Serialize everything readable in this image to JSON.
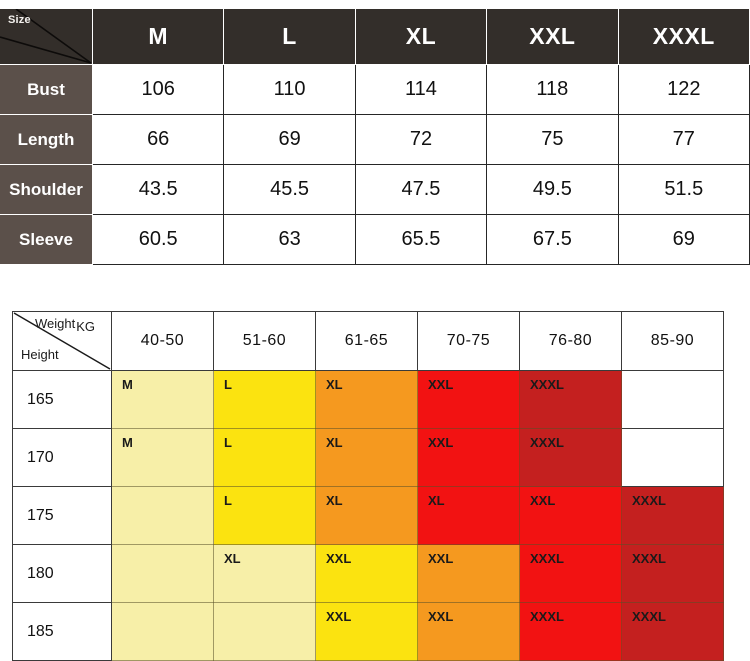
{
  "size_table": {
    "corner_label": "Size",
    "columns": [
      "M",
      "L",
      "XL",
      "XXL",
      "XXXL"
    ],
    "rows": [
      {
        "label": "Bust",
        "values": [
          "106",
          "110",
          "114",
          "118",
          "122"
        ]
      },
      {
        "label": "Length",
        "values": [
          "66",
          "69",
          "72",
          "75",
          "77"
        ]
      },
      {
        "label": "Shoulder",
        "values": [
          "43.5",
          "45.5",
          "47.5",
          "49.5",
          "51.5"
        ]
      },
      {
        "label": "Sleeve",
        "values": [
          "60.5",
          "63",
          "65.5",
          "67.5",
          "69"
        ]
      }
    ],
    "header_bg": "#332e2a",
    "row_label_bg": "#5b504a",
    "cell_bg": "#ffffff"
  },
  "fit_table": {
    "corner_weight_label": "Weight",
    "corner_weight_unit": "KG",
    "corner_height_label": "Height",
    "weight_ranges": [
      "40-50",
      "51-60",
      "61-65",
      "70-75",
      "76-80",
      "85-90"
    ],
    "heights": [
      "165",
      "170",
      "175",
      "180",
      "185"
    ],
    "palette": {
      "pale_yellow": "#f7efa8",
      "yellow": "#fbe310",
      "orange": "#f5991f",
      "red": "#f21212",
      "dark_red": "#c4201f",
      "empty": "#ffffff"
    },
    "grid": [
      [
        {
          "label": "M",
          "color": "pale_yellow"
        },
        {
          "label": "L",
          "color": "yellow"
        },
        {
          "label": "XL",
          "color": "orange"
        },
        {
          "label": "XXL",
          "color": "red"
        },
        {
          "label": "XXXL",
          "color": "dark_red"
        },
        {
          "label": "",
          "color": "empty"
        }
      ],
      [
        {
          "label": "M",
          "color": "pale_yellow"
        },
        {
          "label": "L",
          "color": "yellow"
        },
        {
          "label": "XL",
          "color": "orange"
        },
        {
          "label": "XXL",
          "color": "red"
        },
        {
          "label": "XXXL",
          "color": "dark_red"
        },
        {
          "label": "",
          "color": "empty"
        }
      ],
      [
        {
          "label": "",
          "color": "pale_yellow"
        },
        {
          "label": "L",
          "color": "yellow"
        },
        {
          "label": "XL",
          "color": "orange"
        },
        {
          "label": "XL",
          "color": "red"
        },
        {
          "label": "XXL",
          "color": "red"
        },
        {
          "label": "XXXL",
          "color": "dark_red"
        }
      ],
      [
        {
          "label": "",
          "color": "pale_yellow"
        },
        {
          "label": "XL",
          "color": "pale_yellow"
        },
        {
          "label": "XXL",
          "color": "yellow"
        },
        {
          "label": "XXL",
          "color": "orange"
        },
        {
          "label": "XXXL",
          "color": "red"
        },
        {
          "label": "XXXL",
          "color": "dark_red"
        }
      ],
      [
        {
          "label": "",
          "color": "pale_yellow"
        },
        {
          "label": "",
          "color": "pale_yellow"
        },
        {
          "label": "XXL",
          "color": "yellow"
        },
        {
          "label": "XXL",
          "color": "orange"
        },
        {
          "label": "XXXL",
          "color": "red"
        },
        {
          "label": "XXXL",
          "color": "dark_red"
        }
      ]
    ]
  }
}
